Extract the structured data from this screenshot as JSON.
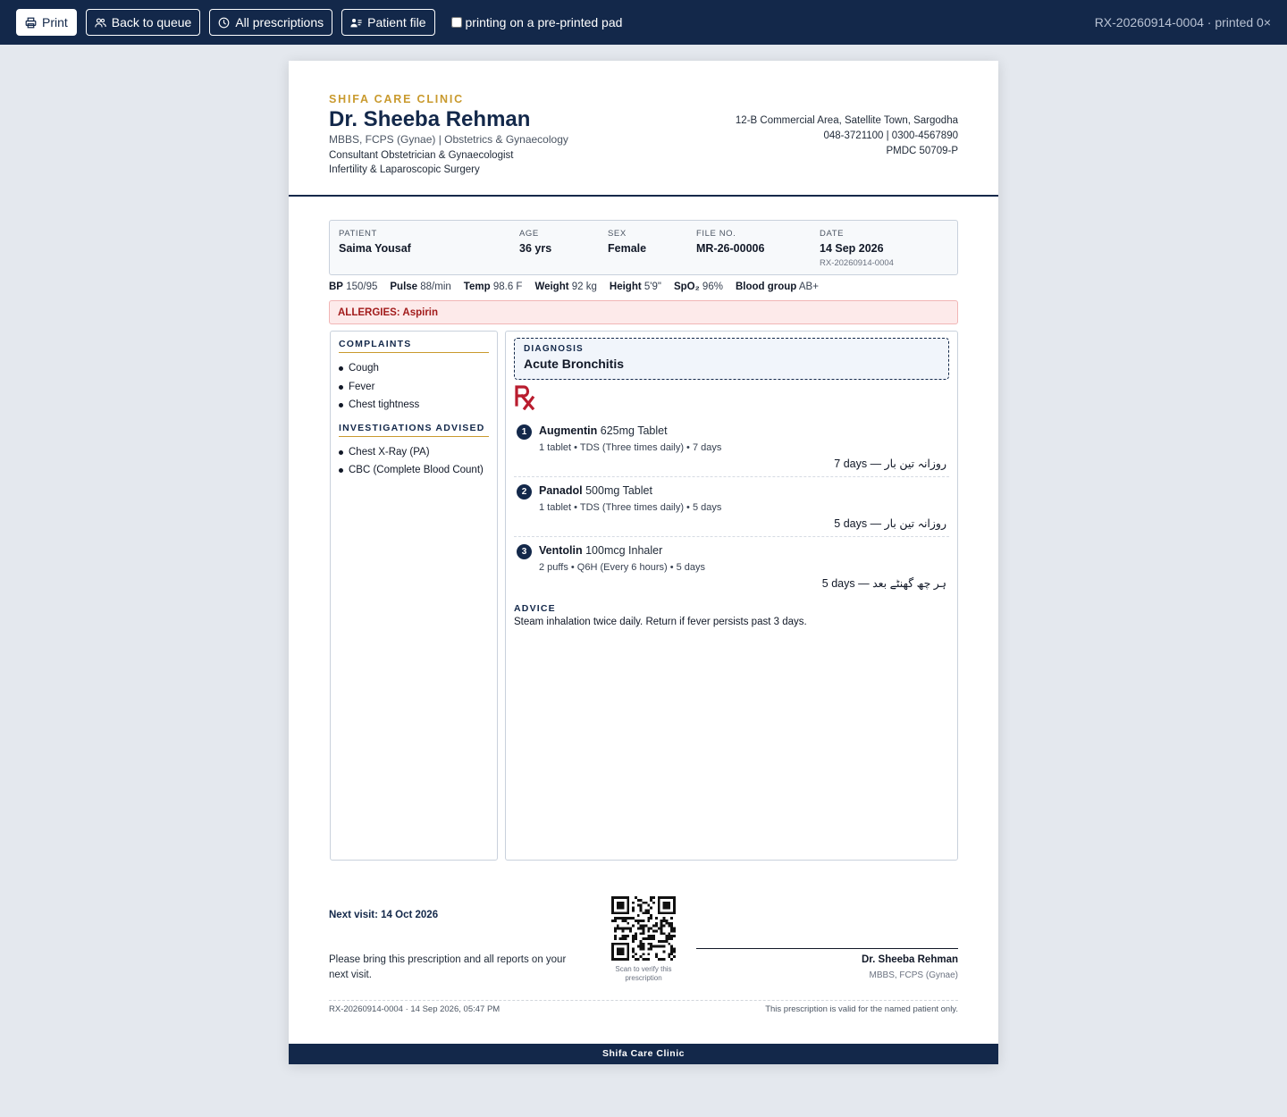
{
  "toolbar": {
    "print_label": "Print",
    "queue_label": "Back to queue",
    "all_rx_label": "All prescriptions",
    "patient_file_label": "Patient file",
    "preprinted_label": "printing on a pre-printed pad",
    "preprinted_checked": false,
    "status": "RX-20260914-0004 · printed 0×"
  },
  "clinic": {
    "name": "SHIFA CARE CLINIC",
    "footer_name": "Shifa Care Clinic",
    "address": "12-B Commercial Area, Satellite Town, Sargodha",
    "phone": "048-3721100 | 0300-4567890",
    "pmdc": "PMDC 50709-P"
  },
  "doctor": {
    "name": "Dr. Sheeba Rehman",
    "quals": "MBBS, FCPS (Gynae)  |  Obstetrics & Gynaecology",
    "role1": "Consultant Obstetrician & Gynaecologist",
    "role2": "Infertility & Laparoscopic Surgery",
    "sig_name": "Dr. Sheeba Rehman",
    "sig_quals": "MBBS, FCPS (Gynae)"
  },
  "patient": {
    "name_label": "PATIENT",
    "name": "Saima Yousaf",
    "age_label": "AGE",
    "age": "36 yrs",
    "sex_label": "SEX",
    "sex": "Female",
    "file_label": "FILE NO.",
    "file": "MR-26-00006",
    "date_label": "DATE",
    "date": "14 Sep 2026",
    "rx_id": "RX-20260914-0004"
  },
  "vitals": [
    {
      "label": "BP",
      "value": "150/95"
    },
    {
      "label": "Pulse",
      "value": "88/min"
    },
    {
      "label": "Temp",
      "value": "98.6 F"
    },
    {
      "label": "Weight",
      "value": "92 kg"
    },
    {
      "label": "Height",
      "value": "5'9\""
    },
    {
      "label": "SpO₂",
      "value": "96%"
    },
    {
      "label": "Blood group",
      "value": "AB+"
    }
  ],
  "allergies": "ALLERGIES: Aspirin",
  "complaints": {
    "title": "COMPLAINTS",
    "items": [
      "Cough",
      "Fever",
      "Chest tightness"
    ]
  },
  "investigations": {
    "title": "INVESTIGATIONS ADVISED",
    "items": [
      "Chest X-Ray (PA)",
      "CBC (Complete Blood Count)"
    ]
  },
  "diagnosis": {
    "label": "DIAGNOSIS",
    "value": "Acute Bronchitis"
  },
  "medications": [
    {
      "num": "1",
      "name": "Augmentin",
      "strength": "625mg Tablet",
      "sig": "1 tablet • TDS (Three times daily) • 7 days",
      "urdu": "روزانہ تین بار",
      "duration": "7 days"
    },
    {
      "num": "2",
      "name": "Panadol",
      "strength": "500mg Tablet",
      "sig": "1 tablet • TDS (Three times daily) • 5 days",
      "urdu": "روزانہ تین بار",
      "duration": "5 days"
    },
    {
      "num": "3",
      "name": "Ventolin",
      "strength": "100mcg Inhaler",
      "sig": "2 puffs • Q6H (Every 6 hours) • 5 days",
      "urdu": "ہر چھ گھنٹے بعد",
      "duration": "5 days"
    }
  ],
  "advice": {
    "label": "ADVICE",
    "text": "Steam inhalation twice daily. Return if fever persists past 3 days."
  },
  "footer": {
    "next_visit": "Next visit: 14 Oct 2026",
    "bring_note": "Please bring this prescription and all reports on your next visit.",
    "qr_caption": "Scan to verify this prescription",
    "meta_left": "RX-20260914-0004 · 14 Sep 2026, 05:47 PM",
    "meta_right": "This prescription is valid for the named patient only."
  },
  "colors": {
    "navy": "#13284a",
    "gold": "#c99a2e",
    "rx_red": "#b91c2e",
    "allergy_red": "#a21c1c"
  }
}
